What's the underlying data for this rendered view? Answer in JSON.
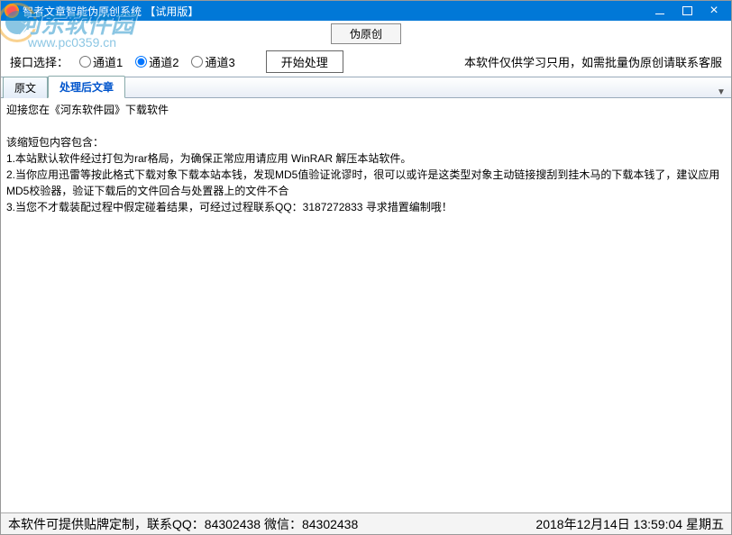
{
  "window": {
    "title": "智者文章智能伪原创系统 【试用版】"
  },
  "watermark": {
    "text": "河东软件园",
    "url": "www.pc0359.cn"
  },
  "toolbar": {
    "fake_original_label": "伪原创",
    "interface_label": "接口选择：",
    "channels": [
      "通道1",
      "通道2",
      "通道3"
    ],
    "selected_channel": 1,
    "start_label": "开始处理",
    "notice": "本软件仅供学习只用，如需批量伪原创请联系客服"
  },
  "tabs": {
    "items": [
      "原文",
      "处理后文章"
    ],
    "active": 1
  },
  "content": {
    "greeting": "迎接您在《河东软件园》下载软件",
    "intro": "该缩短包内容包含：",
    "line1": "1.本站默认软件经过打包为rar格局，为确保正常应用请应用 WinRAR 解压本站软件。",
    "line2": "2.当你应用迅雷等按此格式下载对象下载本站本钱，发现MD5值验证讹谬时，很可以或许是这类型对象主动链接搜刮到挂木马的下载本钱了，建议应用MD5校验器，验证下载后的文件回合与处置器上的文件不合",
    "line3": "3.当您不才载装配过程中假定碰着结果，可经过过程联系QQ：3187272833 寻求措置编制哦！"
  },
  "statusbar": {
    "left": "本软件可提供贴牌定制，联系QQ：84302438 微信：84302438",
    "right": "2018年12月14日 13:59:04 星期五"
  }
}
